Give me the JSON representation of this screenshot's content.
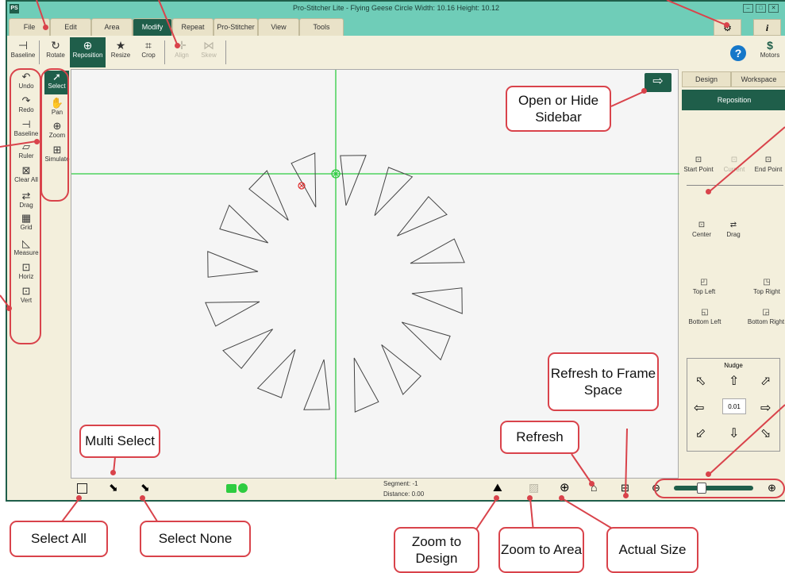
{
  "window": {
    "logo": "PS",
    "title": "Pro-Stitcher Lite  -  Flying Geese Circle   Width: 10.16   Height: 10.12",
    "minimize": "–",
    "maximize": "□",
    "close": "✕"
  },
  "main_tabs": [
    {
      "label": "File"
    },
    {
      "label": "Edit"
    },
    {
      "label": "Area"
    },
    {
      "label": "Modify",
      "active": true
    },
    {
      "label": "Repeat"
    },
    {
      "label": "Pro-Stitcher"
    },
    {
      "label": "View"
    },
    {
      "label": "Tools"
    }
  ],
  "toolbar": {
    "items": [
      {
        "label": "Baseline",
        "icon": "baseline-icon"
      },
      {
        "label": "Rotate",
        "icon": "rotate-icon"
      },
      {
        "label": "Reposition",
        "icon": "reposition-icon",
        "active": true
      },
      {
        "label": "Resize",
        "icon": "resize-star-icon"
      },
      {
        "label": "Crop",
        "icon": "crop-icon"
      },
      {
        "label": "Align",
        "icon": "align-icon",
        "disabled": true
      },
      {
        "label": "Skew",
        "icon": "skew-icon",
        "disabled": true
      }
    ],
    "help_icon": "?",
    "motors_label": "Motors",
    "motors_icon": "$"
  },
  "left_tools": [
    {
      "label": "Undo",
      "icon": "undo-icon"
    },
    {
      "label": "Redo",
      "icon": "redo-icon"
    },
    {
      "label": "Baseline",
      "icon": "baseline-icon"
    },
    {
      "label": "Ruler",
      "icon": "ruler-icon"
    },
    {
      "label": "Clear All",
      "icon": "clear-all-icon"
    },
    {
      "label": "Drag",
      "icon": "drag-icon"
    },
    {
      "label": "Grid",
      "icon": "grid-icon"
    },
    {
      "label": "Measure",
      "icon": "measure-icon"
    },
    {
      "label": "Horiz",
      "icon": "horiz-lock-icon"
    },
    {
      "label": "Vert",
      "icon": "vert-lock-icon"
    }
  ],
  "mode_tools": [
    {
      "label": "Select",
      "icon": "select-arrow-icon",
      "active": true
    },
    {
      "label": "Pan",
      "icon": "pan-hand-icon"
    },
    {
      "label": "Zoom",
      "icon": "zoom-icon"
    },
    {
      "label": "Simulate",
      "icon": "simulate-icon"
    }
  ],
  "sidebar": {
    "tabs": [
      {
        "label": "Design"
      },
      {
        "label": "Workspace"
      }
    ],
    "section_title": "Reposition",
    "start_point": "Start Point",
    "current": "Current",
    "end_point": "End Point",
    "center": "Center",
    "drag": "Drag",
    "top_left": "Top Left",
    "top_right": "Top Right",
    "bottom_left": "Bottom Left",
    "bottom_right": "Bottom Right",
    "nudge_label": "Nudge",
    "nudge_value": "0.01",
    "zoom_level": 0.35
  },
  "status": {
    "segment_label": "Segment:",
    "segment_value": "-1",
    "distance_label": "Distance:",
    "distance_value": "0.00"
  },
  "callouts": {
    "open_sidebar": "Open or Hide Sidebar",
    "refresh_frame": "Refresh to Frame Space",
    "multi_select": "Multi Select",
    "refresh": "Refresh",
    "select_all": "Select All",
    "select_none": "Select None",
    "zoom_design": "Zoom to Design",
    "zoom_area": "Zoom to Area",
    "actual_size": "Actual Size"
  },
  "colors": {
    "titlebar": "#6FCDB8",
    "accent": "#1F5E4A",
    "panel_bg": "#F3EFDC",
    "callout_border": "#D9434B",
    "guide_line": "#2ECC40",
    "start_marker": "#E03030"
  }
}
